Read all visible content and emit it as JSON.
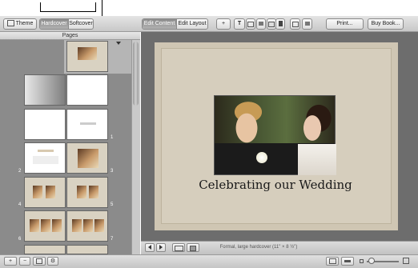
{
  "toolbar": {
    "theme_label": "Theme",
    "cover_options": [
      "Hardcover",
      "Softcover"
    ],
    "selected_cover": "Hardcover",
    "edit_content_label": "Edit Content",
    "edit_layout_label": "Edit Layout",
    "add_label": "+",
    "print_label": "Print...",
    "buy_label": "Buy Book..."
  },
  "pages_pane": {
    "header": "Pages",
    "page_numbers": [
      "1",
      "2",
      "3",
      "4",
      "5",
      "6",
      "7"
    ]
  },
  "page": {
    "title": "Celebrating our Wedding",
    "status": "Formal, large hardcover (11\" × 8 ½\")"
  },
  "bottom": {
    "add_label": "+",
    "remove_label": "−",
    "zoom_value_fraction": 0.15
  },
  "colors": {
    "accent": "#8d8d8d",
    "cover": "#cfc6b3",
    "canvas": "#6d6d6d"
  }
}
